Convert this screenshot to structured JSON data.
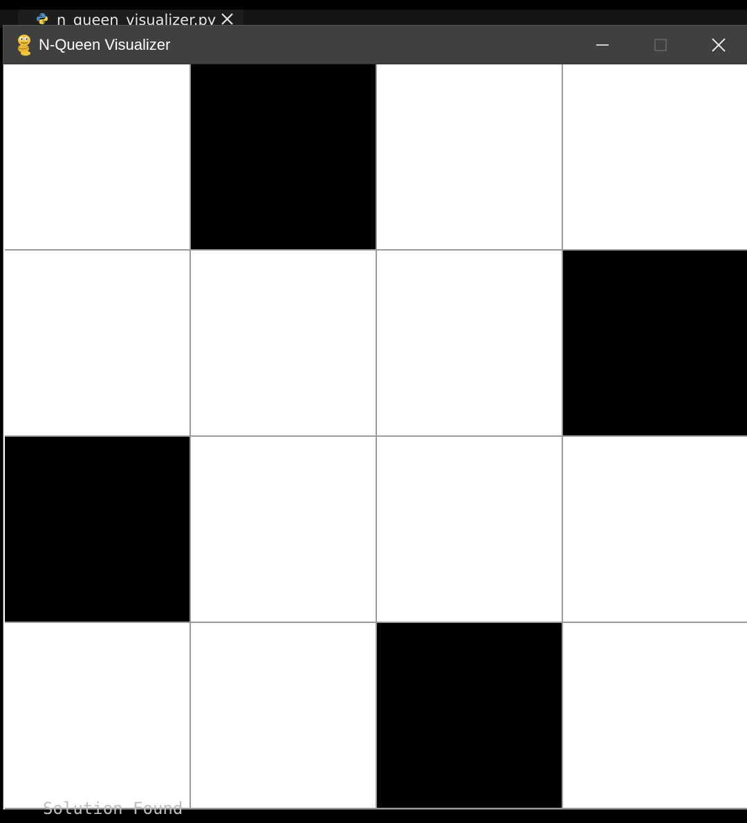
{
  "editor": {
    "tab": {
      "filename": "n_queen_visualizer.py",
      "file_icon": "python-file-icon",
      "close_icon": "close-icon"
    }
  },
  "window": {
    "title": "N-Queen Visualizer",
    "app_icon": "pygame-snake-icon",
    "controls": {
      "minimize_icon": "minimize-icon",
      "maximize_icon": "maximize-icon",
      "close_icon": "close-icon"
    },
    "colors": {
      "titlebar": "#404040",
      "empty_cell": "#ffffff",
      "queen_cell": "#000000",
      "grid_line": "#9a9a9a"
    }
  },
  "board": {
    "n": 4,
    "queen_columns_by_row": [
      1,
      3,
      0,
      2
    ]
  },
  "terminal": {
    "status": "Solution Found"
  }
}
